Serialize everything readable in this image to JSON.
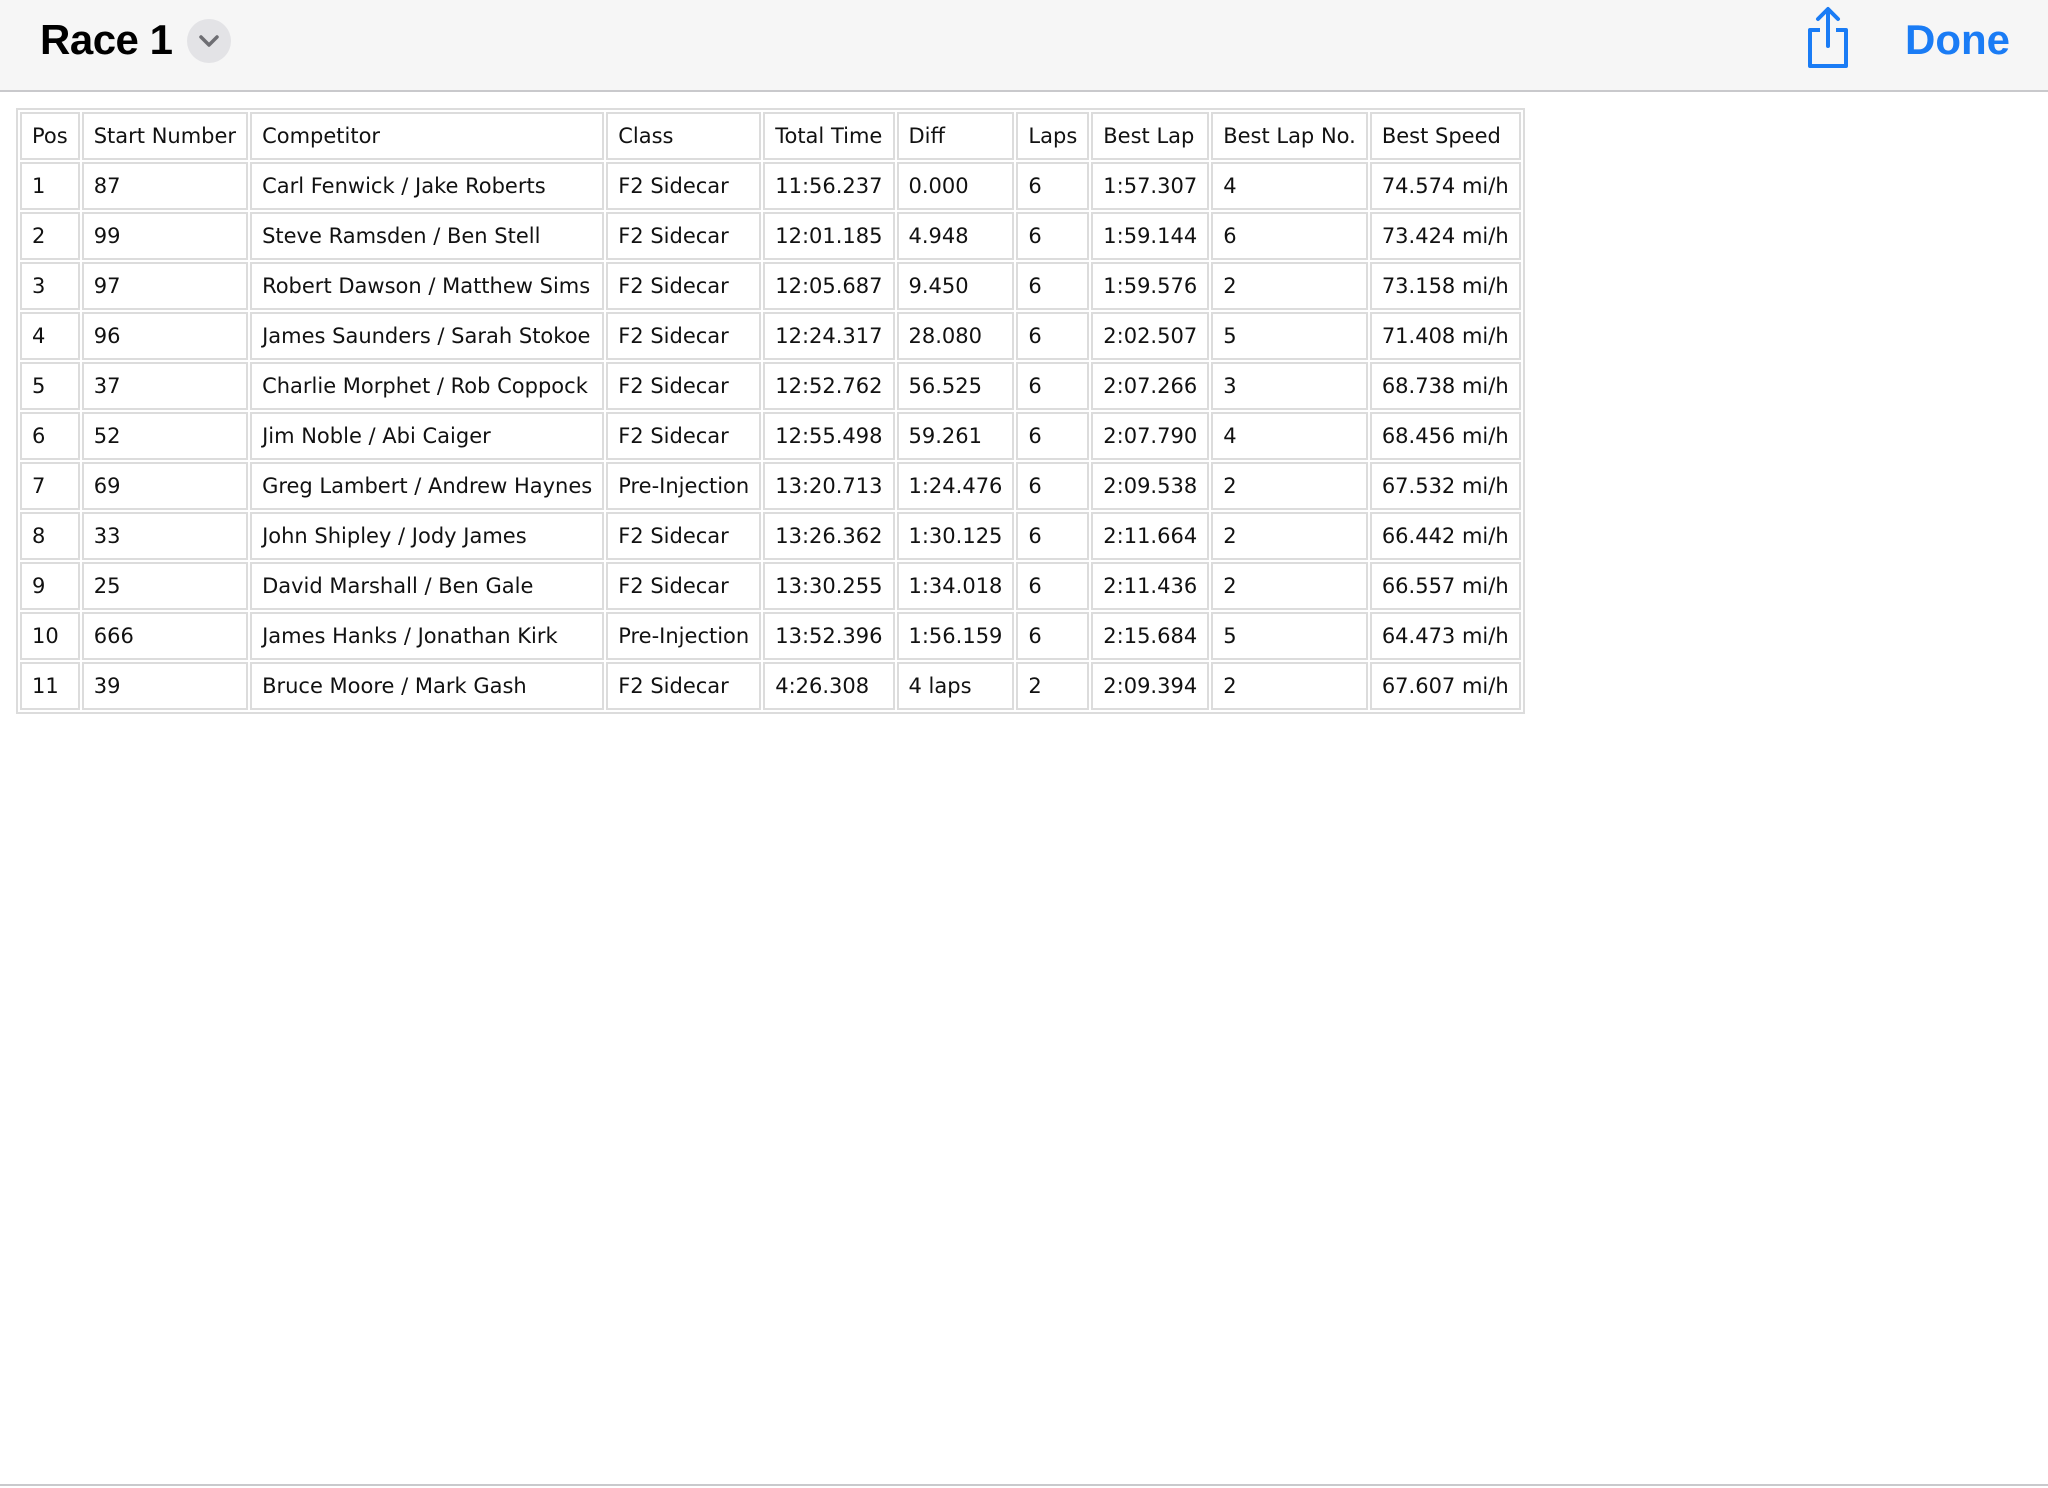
{
  "navbar": {
    "title": "Race 1",
    "done_label": "Done",
    "accent_color": "#1a7cf5",
    "icons": [
      "chevron-down-icon",
      "share-icon"
    ]
  },
  "table": {
    "headers": [
      "Pos",
      "Start Number",
      "Competitor",
      "Class",
      "Total Time",
      "Diff",
      "Laps",
      "Best Lap",
      "Best Lap No.",
      "Best Speed"
    ],
    "rows": [
      [
        "1",
        "87",
        "Carl Fenwick / Jake Roberts",
        "F2 Sidecar",
        "11:56.237",
        "0.000",
        "6",
        "1:57.307",
        "4",
        "74.574 mi/h"
      ],
      [
        "2",
        "99",
        "Steve Ramsden / Ben Stell",
        "F2 Sidecar",
        "12:01.185",
        "4.948",
        "6",
        "1:59.144",
        "6",
        "73.424 mi/h"
      ],
      [
        "3",
        "97",
        "Robert Dawson / Matthew Sims",
        "F2 Sidecar",
        "12:05.687",
        "9.450",
        "6",
        "1:59.576",
        "2",
        "73.158 mi/h"
      ],
      [
        "4",
        "96",
        "James Saunders / Sarah Stokoe",
        "F2 Sidecar",
        "12:24.317",
        "28.080",
        "6",
        "2:02.507",
        "5",
        "71.408 mi/h"
      ],
      [
        "5",
        "37",
        "Charlie Morphet / Rob Coppock",
        "F2 Sidecar",
        "12:52.762",
        "56.525",
        "6",
        "2:07.266",
        "3",
        "68.738 mi/h"
      ],
      [
        "6",
        "52",
        "Jim Noble / Abi Caiger",
        "F2 Sidecar",
        "12:55.498",
        "59.261",
        "6",
        "2:07.790",
        "4",
        "68.456 mi/h"
      ],
      [
        "7",
        "69",
        "Greg Lambert / Andrew Haynes",
        "Pre-Injection",
        "13:20.713",
        "1:24.476",
        "6",
        "2:09.538",
        "2",
        "67.532 mi/h"
      ],
      [
        "8",
        "33",
        "John Shipley / Jody James",
        "F2 Sidecar",
        "13:26.362",
        "1:30.125",
        "6",
        "2:11.664",
        "2",
        "66.442 mi/h"
      ],
      [
        "9",
        "25",
        "David Marshall / Ben Gale",
        "F2 Sidecar",
        "13:30.255",
        "1:34.018",
        "6",
        "2:11.436",
        "2",
        "66.557 mi/h"
      ],
      [
        "10",
        "666",
        "James Hanks / Jonathan Kirk",
        "Pre-Injection",
        "13:52.396",
        "1:56.159",
        "6",
        "2:15.684",
        "5",
        "64.473 mi/h"
      ],
      [
        "11",
        "39",
        "Bruce Moore / Mark Gash",
        "F2 Sidecar",
        "4:26.308",
        "4 laps",
        "2",
        "2:09.394",
        "2",
        "67.607 mi/h"
      ]
    ]
  }
}
